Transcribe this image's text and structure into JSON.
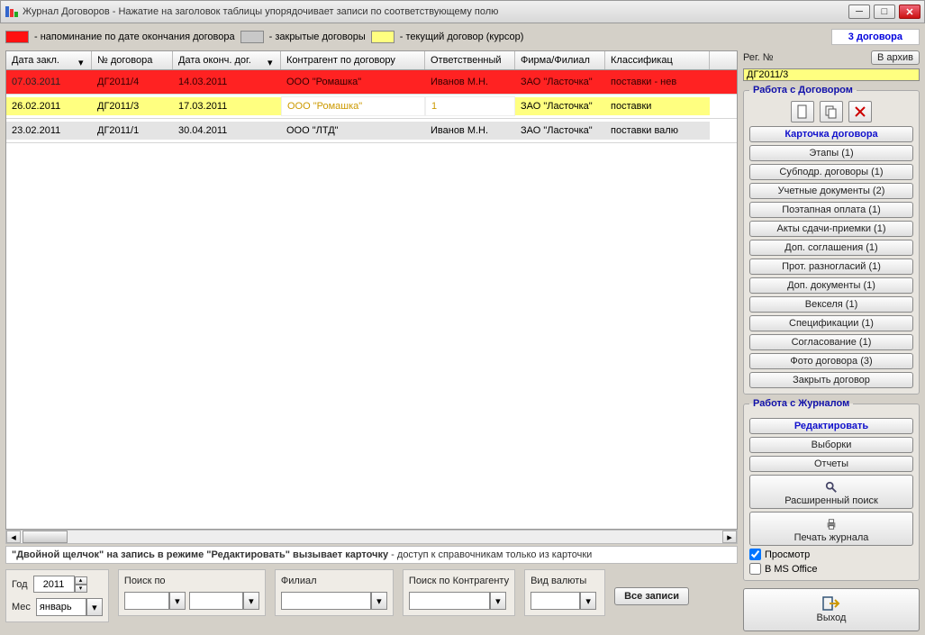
{
  "title": "Журнал Договоров   -   Нажатие на заголовок таблицы упорядочивает записи по соответствующему полю",
  "legend": {
    "red": "- напоминание по дате окончания договора",
    "grey": "- закрытые договоры",
    "yellow": "- текущий договор (курсор)",
    "count": "3 договора"
  },
  "columns": [
    "Дата закл.",
    "№ договора",
    "Дата оконч. дог.",
    "Контрагент по договору",
    "Ответственный",
    "Фирма/Филиал",
    "Классификац"
  ],
  "rows": [
    {
      "cls": "red",
      "cells": [
        "07.03.2011",
        "ДГ2011/4",
        "14.03.2011",
        "ООО \"Ромашка\"",
        "Иванов М.Н.",
        "ЗАО \"Ласточка\"",
        "поставки - нев"
      ]
    },
    {
      "cls": "yellow",
      "cells": [
        "26.02.2011",
        "ДГ2011/3",
        "17.03.2011",
        "ООО \"Ромашка\"",
        "1",
        "ЗАО \"Ласточка\"",
        "поставки"
      ]
    },
    {
      "cls": "grey",
      "cells": [
        "23.02.2011",
        "ДГ2011/1",
        "30.04.2011",
        "ООО \"ЛТД\"",
        "Иванов М.Н.",
        "ЗАО \"Ласточка\"",
        "поставки валю"
      ]
    }
  ],
  "hint": {
    "b1": "\"Двойной щелчок\" на запись в режиме \"Редактировать\" вызывает карточку",
    "rest": "  -  доступ к справочникам только из карточки"
  },
  "filters": {
    "year_lbl": "Год",
    "year": "2011",
    "month_lbl": "Мес",
    "month": "январь",
    "search_lbl": "Поиск по",
    "branch_lbl": "Филиал",
    "search_k_lbl": "Поиск по Контрагенту",
    "currency_lbl": "Вид валюты",
    "all_btn": "Все записи"
  },
  "side": {
    "reg_lbl": "Рег. №",
    "archive_btn": "В архив",
    "reg_val": "ДГ2011/3",
    "fs1_title": "Работа с Договором",
    "btns1": [
      "Карточка договора",
      "Этапы (1)",
      "Субподр. договоры (1)",
      "Учетные документы (2)",
      "Поэтапная оплата (1)",
      "Акты сдачи-приемки (1)",
      "Доп. соглашения (1)",
      "Прот. разногласий (1)",
      "Доп. документы (1)",
      "Векселя (1)",
      "Спецификации (1)",
      "Согласование (1)",
      "Фото договора (3)",
      "Закрыть договор"
    ],
    "fs2_title": "Работа с Журналом",
    "edit_btn": "Редактировать",
    "sel_btn": "Выборки",
    "rep_btn": "Отчеты",
    "adv_btn": "Расширенный поиск",
    "print_btn": "Печать журнала",
    "chk_preview": "Просмотр",
    "chk_office": "В MS Office",
    "exit": "Выход"
  }
}
